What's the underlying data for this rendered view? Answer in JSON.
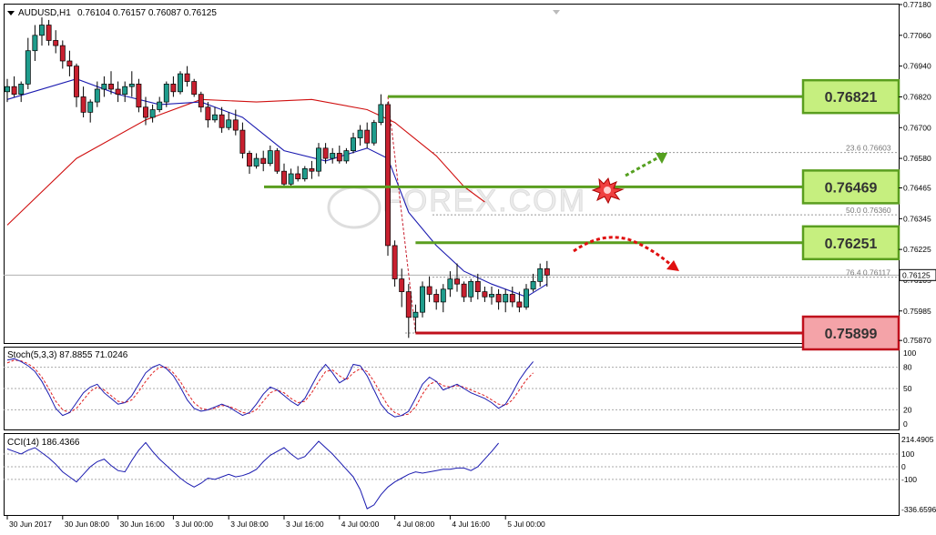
{
  "header": {
    "symbol": "AUDUSD,H1",
    "ohlc": "0.76104 0.76157 0.76087 0.76125"
  },
  "watermark": "FOREX.COM",
  "colors": {
    "bull": "#1f9c8c",
    "bear": "#c8202f",
    "ma_fast": "#1b1bb0",
    "ma_slow": "#d01010",
    "level_green": "#5a9e1f",
    "level_red": "#c0101c",
    "box_green_fill": "#c6ef7f",
    "box_red_fill": "#f4a3a8",
    "fib": "#999999",
    "stoch_k": "#1b1bb0",
    "stoch_d": "#e02020",
    "cci": "#1b1bb0",
    "arrow_up": "#55a020",
    "arrow_down": "#e01010"
  },
  "chart_data": [
    {
      "type": "candlestick",
      "title": "AUDUSD,H1",
      "x_tick_labels": [
        "30 Jun 2017",
        "30 Jun 08:00",
        "30 Jun 16:00",
        "3 Jul 00:00",
        "3 Jul 08:00",
        "3 Jul 16:00",
        "4 Jul 00:00",
        "4 Jul 08:00",
        "4 Jul 16:00",
        "5 Jul 00:00"
      ],
      "y_tick_labels": [
        "0.77180",
        "0.77060",
        "0.76940",
        "0.76820",
        "0.76700",
        "0.76580",
        "0.76465",
        "0.76345",
        "0.76225",
        "0.76105",
        "0.75985",
        "0.75870"
      ],
      "ylim": [
        0.7586,
        0.7718
      ],
      "candles": [
        [
          0.7684,
          0.7689,
          0.768,
          0.7686
        ],
        [
          0.7686,
          0.769,
          0.7682,
          0.7683
        ],
        [
          0.7683,
          0.7688,
          0.768,
          0.7687
        ],
        [
          0.7687,
          0.7705,
          0.7685,
          0.77
        ],
        [
          0.77,
          0.771,
          0.7696,
          0.7706
        ],
        [
          0.7706,
          0.7713,
          0.7702,
          0.771
        ],
        [
          0.771,
          0.7712,
          0.7702,
          0.7704
        ],
        [
          0.7704,
          0.7708,
          0.7699,
          0.7702
        ],
        [
          0.7702,
          0.7704,
          0.7693,
          0.7696
        ],
        [
          0.7696,
          0.77,
          0.769,
          0.7694
        ],
        [
          0.7694,
          0.7695,
          0.7678,
          0.7682
        ],
        [
          0.7682,
          0.7686,
          0.7674,
          0.7676
        ],
        [
          0.7676,
          0.7681,
          0.7672,
          0.768
        ],
        [
          0.768,
          0.7688,
          0.7678,
          0.7685
        ],
        [
          0.7685,
          0.769,
          0.7682,
          0.7687
        ],
        [
          0.7687,
          0.7692,
          0.7683,
          0.7685
        ],
        [
          0.7685,
          0.7688,
          0.768,
          0.7683
        ],
        [
          0.7683,
          0.7688,
          0.768,
          0.7686
        ],
        [
          0.7686,
          0.7692,
          0.7682,
          0.7687
        ],
        [
          0.7687,
          0.7689,
          0.7676,
          0.7678
        ],
        [
          0.7678,
          0.7682,
          0.7671,
          0.7674
        ],
        [
          0.7674,
          0.7679,
          0.7672,
          0.7677
        ],
        [
          0.7677,
          0.7682,
          0.7676,
          0.768
        ],
        [
          0.768,
          0.7688,
          0.7678,
          0.7687
        ],
        [
          0.7687,
          0.769,
          0.7682,
          0.7684
        ],
        [
          0.7684,
          0.7692,
          0.7683,
          0.7691
        ],
        [
          0.7691,
          0.7694,
          0.7686,
          0.7688
        ],
        [
          0.7688,
          0.7689,
          0.7682,
          0.7683
        ],
        [
          0.7683,
          0.7684,
          0.7676,
          0.7678
        ],
        [
          0.7678,
          0.768,
          0.767,
          0.7673
        ],
        [
          0.7673,
          0.7678,
          0.7672,
          0.7675
        ],
        [
          0.7675,
          0.7678,
          0.7668,
          0.767
        ],
        [
          0.767,
          0.7676,
          0.7669,
          0.7673
        ],
        [
          0.7673,
          0.7677,
          0.7667,
          0.7669
        ],
        [
          0.7669,
          0.7672,
          0.7658,
          0.766
        ],
        [
          0.766,
          0.7661,
          0.7652,
          0.7655
        ],
        [
          0.7655,
          0.766,
          0.7654,
          0.7658
        ],
        [
          0.7658,
          0.7661,
          0.7653,
          0.7656
        ],
        [
          0.7656,
          0.7663,
          0.7655,
          0.7661
        ],
        [
          0.7661,
          0.7662,
          0.7652,
          0.7653
        ],
        [
          0.7653,
          0.7656,
          0.7647,
          0.7648
        ],
        [
          0.7648,
          0.7654,
          0.7647,
          0.7652
        ],
        [
          0.7652,
          0.7655,
          0.7649,
          0.765
        ],
        [
          0.765,
          0.7655,
          0.7649,
          0.7654
        ],
        [
          0.7654,
          0.7657,
          0.765,
          0.7653
        ],
        [
          0.7653,
          0.7664,
          0.7651,
          0.7662
        ],
        [
          0.7662,
          0.7664,
          0.7656,
          0.7658
        ],
        [
          0.7658,
          0.7662,
          0.7656,
          0.766
        ],
        [
          0.766,
          0.7663,
          0.7656,
          0.7657
        ],
        [
          0.7657,
          0.7662,
          0.7656,
          0.7661
        ],
        [
          0.7661,
          0.7668,
          0.766,
          0.7666
        ],
        [
          0.7666,
          0.7671,
          0.7663,
          0.7669
        ],
        [
          0.7669,
          0.7672,
          0.7662,
          0.7664
        ],
        [
          0.7664,
          0.7673,
          0.7663,
          0.7672
        ],
        [
          0.7672,
          0.7683,
          0.7671,
          0.7679
        ],
        [
          0.7679,
          0.768,
          0.762,
          0.7624
        ],
        [
          0.7624,
          0.7626,
          0.7608,
          0.7611
        ],
        [
          0.7611,
          0.7615,
          0.76,
          0.7606
        ],
        [
          0.7606,
          0.7609,
          0.7588,
          0.7596
        ],
        [
          0.7596,
          0.7601,
          0.759,
          0.7598
        ],
        [
          0.7598,
          0.761,
          0.7596,
          0.7608
        ],
        [
          0.7608,
          0.7612,
          0.7602,
          0.7605
        ],
        [
          0.7605,
          0.7607,
          0.7599,
          0.7602
        ],
        [
          0.7602,
          0.7609,
          0.7598,
          0.7607
        ],
        [
          0.7607,
          0.7614,
          0.7604,
          0.7611
        ],
        [
          0.7611,
          0.7617,
          0.7606,
          0.7609
        ],
        [
          0.7609,
          0.761,
          0.7602,
          0.7604
        ],
        [
          0.7604,
          0.7611,
          0.7602,
          0.761
        ],
        [
          0.761,
          0.7613,
          0.7603,
          0.7606
        ],
        [
          0.7606,
          0.7608,
          0.7602,
          0.7604
        ],
        [
          0.7604,
          0.7608,
          0.7601,
          0.7605
        ],
        [
          0.7605,
          0.7607,
          0.7599,
          0.7602
        ],
        [
          0.7602,
          0.7607,
          0.7598,
          0.7605
        ],
        [
          0.7605,
          0.7608,
          0.76,
          0.7602
        ],
        [
          0.7602,
          0.7606,
          0.7598,
          0.76
        ],
        [
          0.76,
          0.7609,
          0.7599,
          0.7607
        ],
        [
          0.7607,
          0.7613,
          0.7606,
          0.761
        ],
        [
          0.761,
          0.7617,
          0.7608,
          0.7615
        ],
        [
          0.7615,
          0.7618,
          0.7608,
          0.76125
        ]
      ],
      "ma_fast_name": "",
      "ma_fast": [
        [
          0,
          0.7681
        ],
        [
          10,
          0.7689
        ],
        [
          16,
          0.7683
        ],
        [
          22,
          0.7679
        ],
        [
          28,
          0.768
        ],
        [
          34,
          0.7674
        ],
        [
          40,
          0.7661
        ],
        [
          46,
          0.7657
        ],
        [
          52,
          0.7662
        ],
        [
          55,
          0.7658
        ],
        [
          58,
          0.7637
        ],
        [
          62,
          0.7624
        ],
        [
          66,
          0.7614
        ],
        [
          70,
          0.7609
        ],
        [
          75,
          0.7604
        ],
        [
          78,
          0.7609
        ]
      ],
      "ma_slow_name": "",
      "ma_slow": [
        [
          0,
          0.7632
        ],
        [
          10,
          0.7658
        ],
        [
          20,
          0.7673
        ],
        [
          28,
          0.7681
        ],
        [
          36,
          0.768
        ],
        [
          44,
          0.7681
        ],
        [
          52,
          0.7677
        ],
        [
          56,
          0.7672
        ],
        [
          62,
          0.7659
        ],
        [
          66,
          0.7647
        ],
        [
          69,
          0.7641
        ]
      ],
      "fibonacci": [
        {
          "label": "23.6",
          "price": 0.76603
        },
        {
          "label": "50.0",
          "price": 0.7636
        },
        {
          "label": "76.4",
          "price": 0.76117
        }
      ],
      "current_price_label": "0.76125",
      "levels": [
        {
          "label": "0.76821",
          "value": 0.76821,
          "kind": "resistance",
          "from_bar": 55
        },
        {
          "label": "0.76469",
          "value": 0.76469,
          "kind": "resistance",
          "from_bar": 38
        },
        {
          "label": "0.76251",
          "value": 0.76251,
          "kind": "resistance",
          "from_bar": 59
        },
        {
          "label": "0.75899",
          "value": 0.75899,
          "kind": "support",
          "from_bar": 59
        }
      ]
    },
    {
      "type": "line",
      "title": "Stoch(5,3,3) 87.8855 71.0246",
      "ylim": [
        0,
        100
      ],
      "y_tick_labels": [
        "100",
        "80",
        "50",
        "20",
        "0"
      ],
      "series": [
        {
          "values": [
            90,
            92,
            88,
            82,
            74,
            60,
            42,
            22,
            12,
            16,
            30,
            44,
            52,
            56,
            44,
            36,
            28,
            30,
            40,
            56,
            72,
            80,
            84,
            78,
            68,
            52,
            34,
            22,
            18,
            20,
            24,
            28,
            24,
            18,
            12,
            16,
            28,
            42,
            52,
            48,
            40,
            32,
            26,
            36,
            54,
            72,
            84,
            72,
            58,
            64,
            84,
            82,
            68,
            48,
            28,
            16,
            10,
            12,
            18,
            36,
            56,
            66,
            60,
            48,
            52,
            56,
            50,
            44,
            40,
            36,
            30,
            22,
            28,
            44,
            62,
            76,
            88
          ]
        },
        {
          "values": [
            86,
            90,
            89,
            85,
            78,
            66,
            50,
            32,
            20,
            16,
            22,
            34,
            46,
            52,
            48,
            40,
            32,
            30,
            34,
            46,
            60,
            72,
            80,
            80,
            72,
            60,
            44,
            30,
            22,
            20,
            22,
            26,
            25,
            21,
            16,
            15,
            20,
            32,
            44,
            48,
            44,
            36,
            30,
            32,
            44,
            60,
            74,
            76,
            68,
            62,
            72,
            78,
            74,
            60,
            42,
            26,
            16,
            12,
            14,
            24,
            42,
            56,
            60,
            54,
            52,
            54,
            52,
            48,
            44,
            40,
            34,
            28,
            26,
            34,
            48,
            62,
            72
          ]
        }
      ]
    },
    {
      "type": "line",
      "title": "CCI(14) 186.4366",
      "ylim": [
        -336.6596,
        214.4905
      ],
      "y_tick_labels": [
        "214.4905",
        "100",
        "0",
        "-100",
        "-336.6596"
      ],
      "series": [
        {
          "values": [
            140,
            120,
            100,
            130,
            150,
            110,
            70,
            20,
            -40,
            -80,
            -120,
            -60,
            0,
            40,
            60,
            10,
            -30,
            -40,
            50,
            130,
            190,
            120,
            60,
            10,
            -40,
            -90,
            -130,
            -160,
            -130,
            -90,
            -100,
            -80,
            -60,
            -80,
            -70,
            -50,
            -20,
            40,
            90,
            120,
            150,
            100,
            60,
            80,
            140,
            200,
            150,
            100,
            40,
            -20,
            -80,
            -180,
            -330,
            -300,
            -220,
            -160,
            -120,
            -90,
            -60,
            -40,
            -50,
            -40,
            -30,
            -20,
            -20,
            -10,
            -10,
            -30,
            0,
            60,
            120,
            186
          ]
        }
      ]
    }
  ]
}
